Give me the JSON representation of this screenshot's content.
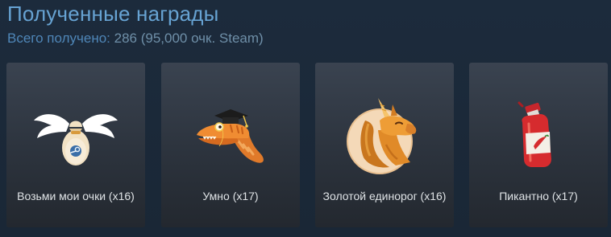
{
  "header": {
    "title": "Полученные награды",
    "summary_prefix": "Всего получено:",
    "summary_value": "286 (95,000 очк. Steam)"
  },
  "awards": [
    {
      "label": "Возьми мои очки (x16)",
      "icon": "flying-money-bag-icon"
    },
    {
      "label": "Умно (x17)",
      "icon": "graduate-crocodile-icon"
    },
    {
      "label": "Золотой единорог (x16)",
      "icon": "golden-unicorn-icon"
    },
    {
      "label": "Пикантно (x17)",
      "icon": "hot-sauce-icon"
    }
  ],
  "colors": {
    "background": "#1b2838",
    "title": "#67a3d3",
    "summary": "#4f86b8",
    "card_top": "#3a4350",
    "card_bottom": "#23282f",
    "label": "#dfe3e6"
  }
}
